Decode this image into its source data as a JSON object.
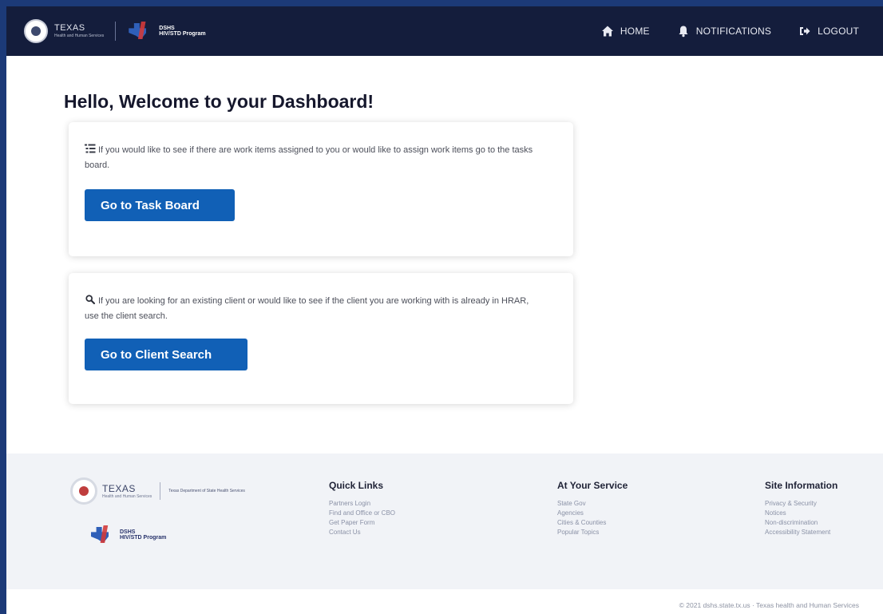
{
  "header": {
    "hhs_logo": {
      "line1": "TEXAS",
      "line2": "Health and Human Services"
    },
    "dshs_logo": {
      "line1": "DSHS",
      "line2": "HIV/STD Program"
    },
    "nav": [
      {
        "label": "HOME",
        "icon": "home-icon"
      },
      {
        "label": "NOTIFICATIONS",
        "icon": "bell-icon"
      },
      {
        "label": "LOGOUT",
        "icon": "logout-icon"
      }
    ]
  },
  "main": {
    "title": "Hello, Welcome to your Dashboard!",
    "cards": [
      {
        "icon": "list-icon",
        "text": "If you would like to see if there are work items assigned to you or would like to assign work items go to the tasks board.",
        "button": "Go to Task Board"
      },
      {
        "icon": "search-icon",
        "text": "If you are looking for an existing client or would like to see if the client you are working with is already in HRAR, use the client search.",
        "button": "Go to Client Search"
      }
    ]
  },
  "footer": {
    "hhs_logo": {
      "line1": "TEXAS",
      "line2": "Health and Human Services",
      "dept": "Texas Department of State Health Services"
    },
    "dshs_logo": {
      "line1": "DSHS",
      "line2": "HIV/STD Program"
    },
    "columns": [
      {
        "title": "Quick Links",
        "links": [
          "Partners Login",
          "Find and Office or CBO",
          "Get Paper Form",
          "Contact Us"
        ]
      },
      {
        "title": "At Your Service",
        "links": [
          "State Gov",
          "Agencies",
          "Cities & Counties",
          "Popular Topics"
        ]
      },
      {
        "title": "Site Information",
        "links": [
          "Privacy & Security",
          "Notices",
          "Non-discrimination",
          "Accessibility Statement"
        ]
      }
    ],
    "copyright": "© 2021 dshs.state.tx.us · Texas health and Human Services"
  },
  "colors": {
    "header_bg": "#141d3c",
    "button_bg": "#1160b6",
    "page_border": "#1c3a78",
    "footer_bg": "#f1f3f7"
  }
}
